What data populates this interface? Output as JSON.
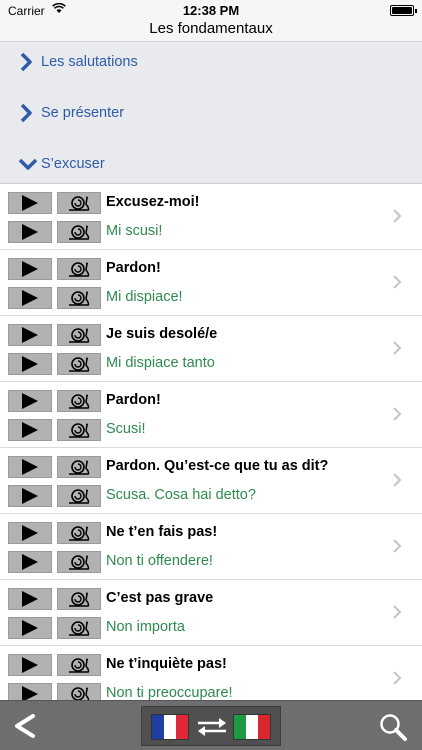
{
  "status": {
    "carrier": "Carrier",
    "time": "12:38 PM"
  },
  "title": "Les fondamentaux",
  "categories": [
    {
      "label": "Les salutations",
      "icon": "chevron-right-icon",
      "expanded": false
    },
    {
      "label": "Se présenter",
      "icon": "chevron-right-icon",
      "expanded": false
    },
    {
      "label": "S’excuser",
      "icon": "chevron-down-icon",
      "expanded": true
    }
  ],
  "phrases": [
    {
      "fr": "Excusez-moi!",
      "it": "Mi scusi!"
    },
    {
      "fr": "Pardon!",
      "it": "Mi dispiace!"
    },
    {
      "fr": "Je suis desolé/e",
      "it": "Mi dispiace tanto"
    },
    {
      "fr": "Pardon!",
      "it": "Scusi!"
    },
    {
      "fr": "Pardon. Qu’est-ce que tu as dit?",
      "it": "Scusa. Cosa hai detto?"
    },
    {
      "fr": "Ne t’en fais pas!",
      "it": "Non ti offendere!"
    },
    {
      "fr": "C’est pas grave",
      "it": "Non importa"
    },
    {
      "fr": "Ne t’inquiète pas!",
      "it": "Non ti preoccupare!"
    }
  ],
  "toolbar": {
    "back_icon": "back-chevron-icon",
    "languages": {
      "from": "French",
      "to": "Italian"
    },
    "swap_icon": "swap-arrows-icon",
    "search_icon": "search-icon"
  },
  "colors": {
    "category_text": "#2e5aa8",
    "translation_text": "#2f8a4e",
    "category_background": "#e9eaee",
    "toolbar_background": "#6e6e6e",
    "button_background": "#b2b2b2"
  }
}
